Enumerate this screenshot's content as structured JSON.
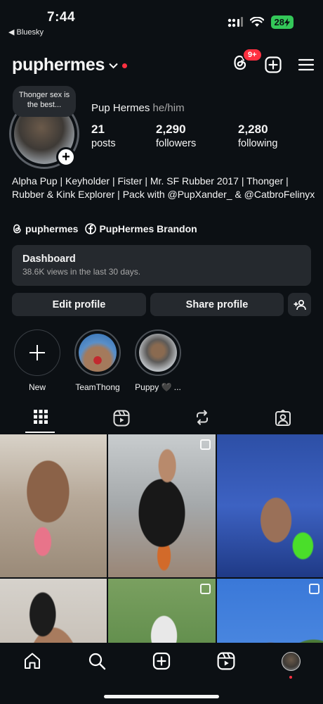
{
  "status_bar": {
    "time": "7:44",
    "back_app": "◀ Bluesky",
    "battery": "28"
  },
  "header": {
    "username": "puphermes",
    "notification_badge": "9+"
  },
  "profile": {
    "note": "Thonger sex is the best...",
    "display_name": "Pup Hermes",
    "pronouns": "he/him",
    "stats": [
      {
        "value": "21",
        "label": "posts"
      },
      {
        "value": "2,290",
        "label": "followers"
      },
      {
        "value": "2,280",
        "label": "following"
      }
    ],
    "bio": "Alpha Pup | Keyholder | Fister | Mr. SF Rubber 2017 | Thonger | Rubber & Kink Explorer | Pack with @PupXander_ & @CatbroFelinyx",
    "threads_link": "puphermes",
    "facebook_link": "PupHermes Brandon"
  },
  "dashboard": {
    "title": "Dashboard",
    "subtitle": "38.6K views in the last 30 days."
  },
  "buttons": {
    "edit_profile": "Edit profile",
    "share_profile": "Share profile"
  },
  "highlights": [
    {
      "label": "New"
    },
    {
      "label": "TeamThong"
    },
    {
      "label": "Puppy 🖤 ..."
    }
  ],
  "tabs": [
    "grid-icon",
    "reels-icon",
    "reposts-icon",
    "tagged-icon"
  ],
  "colors": {
    "background": "#0c1014",
    "card": "#25292e",
    "accent_red": "#ff3040",
    "battery_green": "#34c759"
  }
}
